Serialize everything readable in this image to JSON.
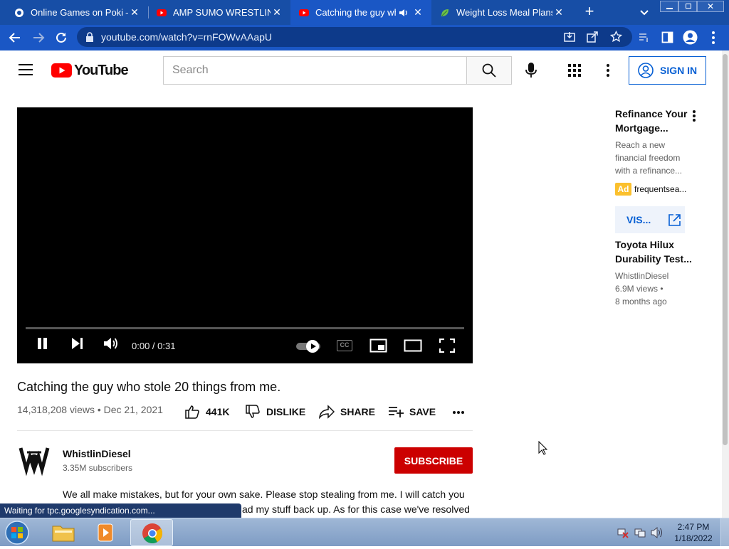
{
  "browser": {
    "tabs": [
      {
        "title": "Online Games on Poki —",
        "favicon": "poki-icon"
      },
      {
        "title": "AMP SUMO WRESTLING",
        "favicon": "youtube-icon"
      },
      {
        "title": "Catching the guy who",
        "favicon": "youtube-icon",
        "active": true
      },
      {
        "title": "Weight Loss Meal Plans fr",
        "favicon": "leaf-icon"
      }
    ],
    "url": "youtube.com/watch?v=rnFOWvAAapU",
    "status": "Waiting for tpc.googlesyndication.com..."
  },
  "youtube": {
    "logo_text": "YouTube",
    "search_placeholder": "Search",
    "signin_label": "SIGN IN"
  },
  "player": {
    "time": "0:00 / 0:31",
    "progress": 0
  },
  "video": {
    "title": "Catching the guy who stole 20 things from me.",
    "info": "14,318,208 views • Dec 21, 2021",
    "like_count": "441K",
    "dislike_label": "DISLIKE",
    "share_label": "SHARE",
    "save_label": "SAVE"
  },
  "channel": {
    "name": "WhistlinDiesel",
    "subscribers": "3.35M subscribers",
    "subscribe_label": "SUBSCRIBE",
    "description_line1": "We all make mistakes, but for your own sake. Please stop stealing from me. I will catch you",
    "description_line2": "ad my stuff back up. As for this case we've resolved"
  },
  "sidebar": {
    "ad": {
      "title_line1": "Refinance Your",
      "title_line2": "Mortgage...",
      "desc_line1": "Reach a new",
      "desc_line2": "financial freedom",
      "desc_line3": "with a refinance...",
      "badge": "Ad",
      "source": "frequentsea...",
      "visit_label": "VIS..."
    },
    "video": {
      "title_line1": "Toyota Hilux",
      "title_line2": "Durability Test...",
      "channel": "WhistlinDiesel",
      "views": "6.9M views •",
      "age": "8 months ago"
    }
  },
  "taskbar": {
    "time": "2:47 PM",
    "date": "1/18/2022"
  },
  "colors": {
    "chrome_blue": "#1a57c5",
    "youtube_red": "#ff0000",
    "subscribe_red": "#cc0000",
    "link_blue": "#065fd4"
  }
}
